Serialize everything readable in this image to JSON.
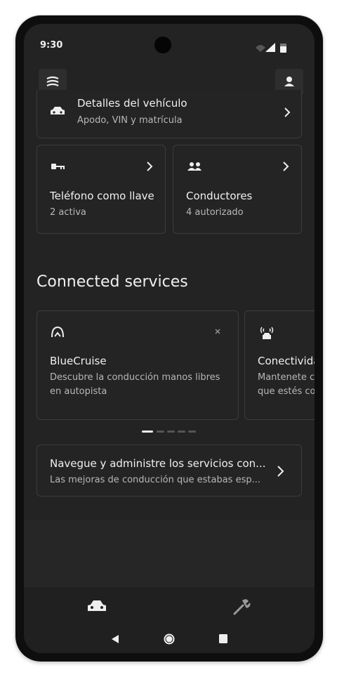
{
  "status_bar": {
    "time": "9:30"
  },
  "vehicle_details": {
    "title": "Detalles del vehículo",
    "subtitle": "Apodo, VIN y matrícula"
  },
  "phone_key": {
    "title": "Teléfono como llave",
    "subtitle": "2 activa"
  },
  "drivers": {
    "title": "Conductores",
    "subtitle": "4 autorizado"
  },
  "connected": {
    "heading": "Connected services"
  },
  "bluecruise": {
    "title": "BlueCruise",
    "line1": "Descubre la conducción manos libres",
    "line2": "en autopista"
  },
  "connectivity": {
    "title": "Conectivida",
    "line1": "Mantenete c",
    "line2": "que estés co"
  },
  "carousel": {
    "pages": 5,
    "active": 1
  },
  "manage": {
    "title": "Navegue y administre los servicios con...",
    "subtitle": "Las mejoras de conducción que estabas esp..."
  },
  "icons": [
    "menu-icon",
    "profile-icon",
    "car-icon",
    "key-icon",
    "people-icon",
    "bluecruise-icon",
    "connectivity-icon",
    "close-icon",
    "chevron-right-icon",
    "wrench-icon",
    "back-icon",
    "home-icon",
    "recents-icon"
  ]
}
